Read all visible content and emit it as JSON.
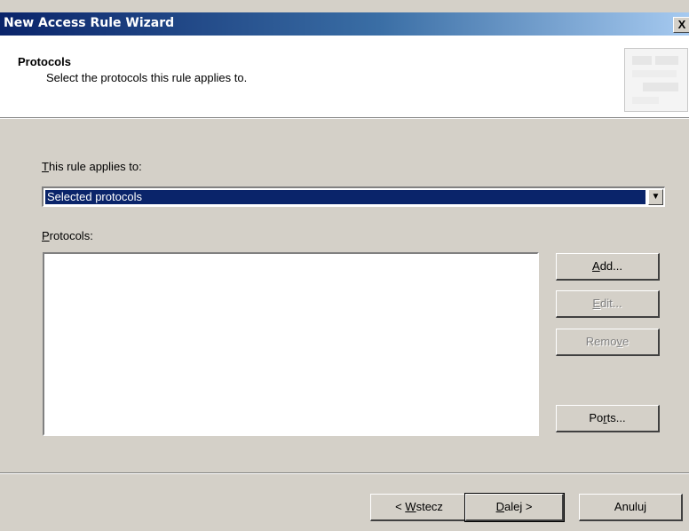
{
  "window": {
    "title": "New Access Rule Wizard",
    "close_label": "X"
  },
  "header": {
    "title": "Protocols",
    "subtitle": "Select the protocols this rule applies to."
  },
  "rule": {
    "applies_label_first": "T",
    "applies_label_rest": "his rule applies to:",
    "combo_value": "Selected protocols",
    "combo_arrow": "▼"
  },
  "protocols": {
    "label_first": "P",
    "label_rest": "rotocols:",
    "items": []
  },
  "buttons": {
    "add": {
      "pre": "",
      "key": "A",
      "post": "dd...",
      "enabled": true
    },
    "edit": {
      "pre": "",
      "key": "E",
      "post": "dit...",
      "enabled": false
    },
    "remove": {
      "pre": "Remo",
      "key": "v",
      "post": "e",
      "enabled": false
    },
    "ports": {
      "pre": "Po",
      "key": "r",
      "post": "ts...",
      "enabled": true
    }
  },
  "footer": {
    "back": {
      "pre": "< ",
      "key": "W",
      "post": "stecz"
    },
    "next": {
      "pre": "",
      "key": "D",
      "post": "alej >"
    },
    "cancel": "Anuluj"
  },
  "colors": {
    "titlebar_start": "#0a246a",
    "titlebar_end": "#a6caf0",
    "face": "#d4d0c8",
    "selection": "#0a246a"
  }
}
